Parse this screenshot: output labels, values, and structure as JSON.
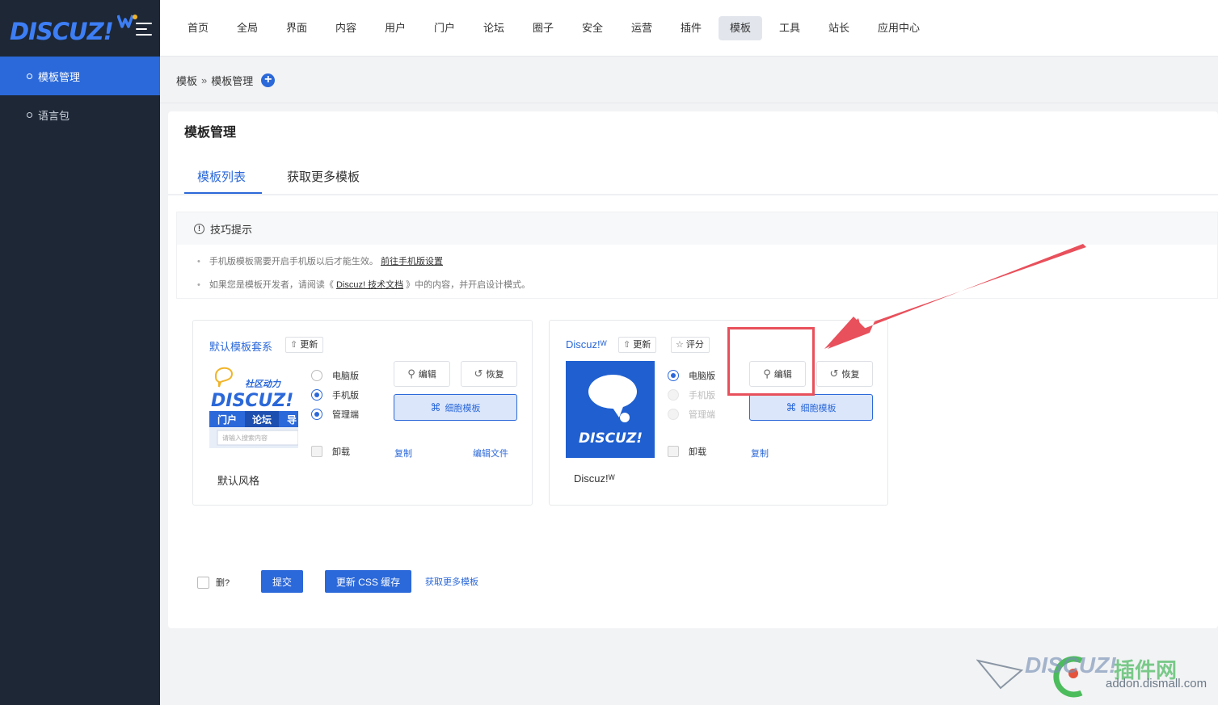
{
  "logo": {
    "text": "DISCUZ!"
  },
  "sidebar": {
    "items": [
      {
        "label": "模板管理",
        "active": true
      },
      {
        "label": "语言包",
        "active": false
      }
    ]
  },
  "topnav": {
    "items": [
      "首页",
      "全局",
      "界面",
      "内容",
      "用户",
      "门户",
      "论坛",
      "圈子",
      "安全",
      "运营",
      "插件",
      "模板",
      "工具",
      "站长",
      "应用中心"
    ],
    "active": "模板"
  },
  "breadcrumb": {
    "root": "模板",
    "sep": "»",
    "current": "模板管理",
    "add": "+"
  },
  "panel": {
    "title": "模板管理",
    "tabs": [
      "模板列表",
      "获取更多模板"
    ],
    "tips": {
      "heading": "技巧提示",
      "lines": [
        {
          "text": "手机版模板需要开启手机版以后才能生效。",
          "link": "前往手机版设置",
          "suffix": ""
        },
        {
          "text": "如果您是模板开发者，请阅读《",
          "link": "Discuz! 技术文档",
          "suffix": "》中的内容，并开启设计模式。"
        }
      ]
    }
  },
  "cards": [
    {
      "title": "默认模板套系",
      "update_label": "更新",
      "thumb": {
        "tagline": "社区动力",
        "brand": "DISCUZ!",
        "tabs": [
          "门户",
          "论坛",
          "导"
        ],
        "search_placeholder": "请输入搜索内容"
      },
      "options": [
        {
          "label": "电脑版",
          "checked": false,
          "disabled": false
        },
        {
          "label": "手机版",
          "checked": true,
          "disabled": false
        },
        {
          "label": "管理端",
          "checked": true,
          "disabled": false
        }
      ],
      "edit_label": "编辑",
      "restore_label": "恢复",
      "cell_label": "细胞模板",
      "uninstall_label": "卸载",
      "copy_label": "复制",
      "edit_file_label": "编辑文件",
      "name": "默认风格"
    },
    {
      "title": "Discuz!ᵂ",
      "update_label": "更新",
      "rate_label": "评分",
      "thumb": {
        "brand": "DISCUZ!"
      },
      "options": [
        {
          "label": "电脑版",
          "checked": true,
          "disabled": false
        },
        {
          "label": "手机版",
          "checked": false,
          "disabled": true
        },
        {
          "label": "管理端",
          "checked": false,
          "disabled": true
        }
      ],
      "edit_label": "编辑",
      "restore_label": "恢复",
      "cell_label": "细胞模板",
      "uninstall_label": "卸载",
      "copy_label": "复制",
      "name": "Discuz!ᵂ"
    }
  ],
  "form": {
    "delete_label": "删?",
    "submit_label": "提交",
    "update_css_label": "更新 CSS 缓存",
    "more_label": "获取更多模板"
  },
  "watermark": {
    "brand": "DISCUZ!",
    "cn": "插件网",
    "url": "addon.dismall.com"
  },
  "colors": {
    "accent": "#2b68d9",
    "sidebar": "#1d2736",
    "annotation": "#e8505b"
  }
}
